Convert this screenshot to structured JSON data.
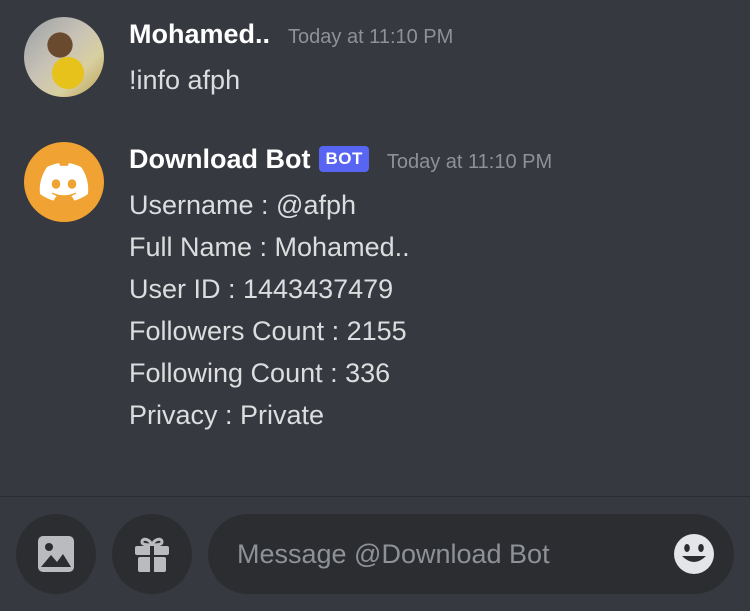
{
  "messages": [
    {
      "author": "Mohamed..",
      "timestamp": "Today at 11:10 PM",
      "lines": [
        "!info afph"
      ]
    },
    {
      "author": "Download Bot",
      "badge": "BOT",
      "timestamp": "Today at 11:10 PM",
      "lines": [
        "Username : @afph",
        "Full Name : Mohamed..",
        "User ID : 1443437479",
        "Followers Count : 2155",
        "Following Count : 336",
        "Privacy : Private"
      ]
    }
  ],
  "composer": {
    "placeholder": "Message @Download Bot",
    "icons": [
      "image-icon",
      "gift-icon",
      "emoji-icon"
    ]
  },
  "colors": {
    "background": "#36393f",
    "input_background": "#2b2d31",
    "bot_badge": "#5865f2",
    "bot_avatar": "#f0a232",
    "muted_text": "#8e9297"
  }
}
